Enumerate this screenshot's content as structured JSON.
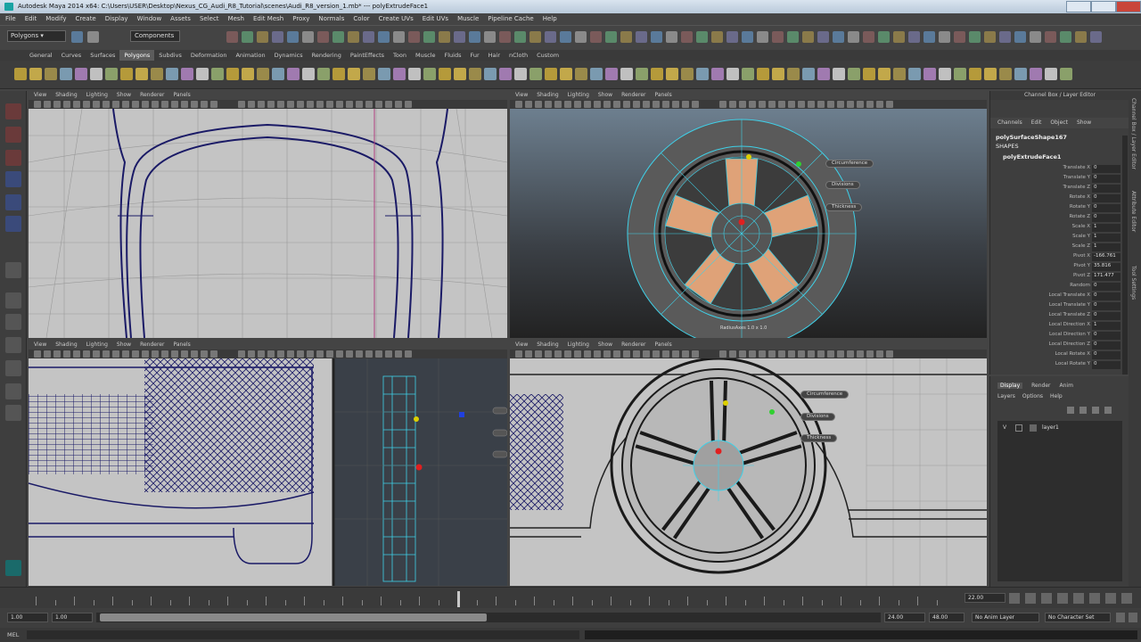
{
  "titlebar": {
    "title": "Autodesk Maya 2014 x64: C:\\Users\\USER\\Desktop\\Nexus_CG_Audi_R8_Tutorial\\scenes\\Audi_R8_version_1.mb*  ---  polyExtrudeFace1"
  },
  "menus": [
    "File",
    "Edit",
    "Modify",
    "Create",
    "Display",
    "Window",
    "Assets",
    "Select",
    "Mesh",
    "Edit Mesh",
    "Proxy",
    "Normals",
    "Color",
    "Create UVs",
    "Edit UVs",
    "Muscle",
    "Pipeline Cache",
    "Help"
  ],
  "statusline": {
    "mode": "Polygons",
    "object_mode_label": "Components"
  },
  "shelf_tabs": [
    "General",
    "Curves",
    "Surfaces",
    "Polygons",
    "Subdivs",
    "Deformation",
    "Animation",
    "Dynamics",
    "Rendering",
    "PaintEffects",
    "Toon",
    "Muscle",
    "Fluids",
    "Fur",
    "Hair",
    "nCloth",
    "Custom"
  ],
  "shelf_active": "Polygons",
  "panel_menu": [
    "View",
    "Shading",
    "Lighting",
    "Show",
    "Renderer",
    "Panels"
  ],
  "viewport_labels": {
    "persp_handles": [
      "Circumference",
      "Divisions",
      "Thickness"
    ],
    "persp_footer": "RadiusAxes   1.0 x 1.0",
    "bottom_handles": [
      "Circumference",
      "Divisions",
      "Thickness"
    ]
  },
  "channel_box": {
    "header": "Channel Box / Layer Editor",
    "tabs": [
      "Channels",
      "Edit",
      "Object",
      "Show"
    ],
    "object": "polySurfaceShape167",
    "shapes": "SHAPES",
    "input": "polyExtrudeFace1",
    "rows": [
      {
        "label": "Translate X",
        "value": "0"
      },
      {
        "label": "Translate Y",
        "value": "0"
      },
      {
        "label": "Translate Z",
        "value": "0"
      },
      {
        "label": "Rotate X",
        "value": "0"
      },
      {
        "label": "Rotate Y",
        "value": "0"
      },
      {
        "label": "Rotate Z",
        "value": "0"
      },
      {
        "label": "Scale X",
        "value": "1"
      },
      {
        "label": "Scale Y",
        "value": "1"
      },
      {
        "label": "Scale Z",
        "value": "1"
      },
      {
        "label": "Pivot X",
        "value": "-166.761"
      },
      {
        "label": "Pivot Y",
        "value": "35.816"
      },
      {
        "label": "Pivot Z",
        "value": "171.477"
      },
      {
        "label": "Random",
        "value": "0"
      },
      {
        "label": "Local Translate X",
        "value": "0"
      },
      {
        "label": "Local Translate Y",
        "value": "0"
      },
      {
        "label": "Local Translate Z",
        "value": "0"
      },
      {
        "label": "Local Direction X",
        "value": "1"
      },
      {
        "label": "Local Direction Y",
        "value": "0"
      },
      {
        "label": "Local Direction Z",
        "value": "0"
      },
      {
        "label": "Local Rotate X",
        "value": "0"
      },
      {
        "label": "Local Rotate Y",
        "value": "0"
      }
    ]
  },
  "side_tabs": [
    "Channel Box / Layer Editor",
    "Attribute Editor",
    "Tool Settings"
  ],
  "layer_panel": {
    "tabs": [
      "Display",
      "Render",
      "Anim"
    ],
    "active_tab": "Display",
    "menu": [
      "Layers",
      "Options",
      "Help"
    ],
    "layer_name": "layer1",
    "v_flag": "V"
  },
  "time": {
    "current_frame": "22.00",
    "range_start": "1.00",
    "range_start_inner": "1.00",
    "range_end_inner": "24.00",
    "range_end": "48.00",
    "anim_layer": "No Anim Layer",
    "character_set": "No Character Set"
  },
  "help_line": "MEL",
  "colors": {
    "selection": "#3fd1e8",
    "wireframe": "#1a1a66",
    "face_highlight": "#e8a87c",
    "viewport_grey": "#c4c4c4"
  }
}
